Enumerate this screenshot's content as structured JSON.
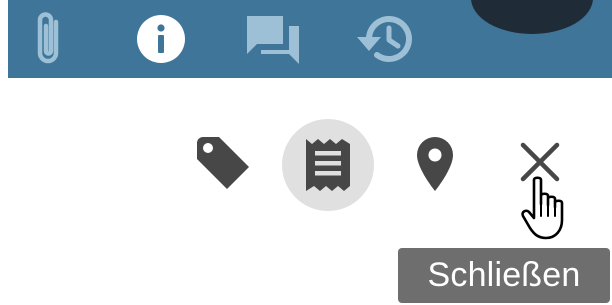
{
  "topbar": {
    "background": "#3f7598",
    "icon_color": "#9ec0d6",
    "tabs": [
      {
        "icon": "paperclip-icon",
        "active": false
      },
      {
        "icon": "info-icon",
        "active": true
      },
      {
        "icon": "comments-icon",
        "active": false
      },
      {
        "icon": "history-icon",
        "active": false
      }
    ]
  },
  "actions": {
    "icon_color": "#474747",
    "items": [
      {
        "icon": "tag-icon"
      },
      {
        "icon": "document-icon",
        "selected": true
      },
      {
        "icon": "location-pin-icon"
      },
      {
        "icon": "close-icon",
        "hovered": true
      }
    ]
  },
  "tooltip": {
    "label": "Schließen"
  }
}
